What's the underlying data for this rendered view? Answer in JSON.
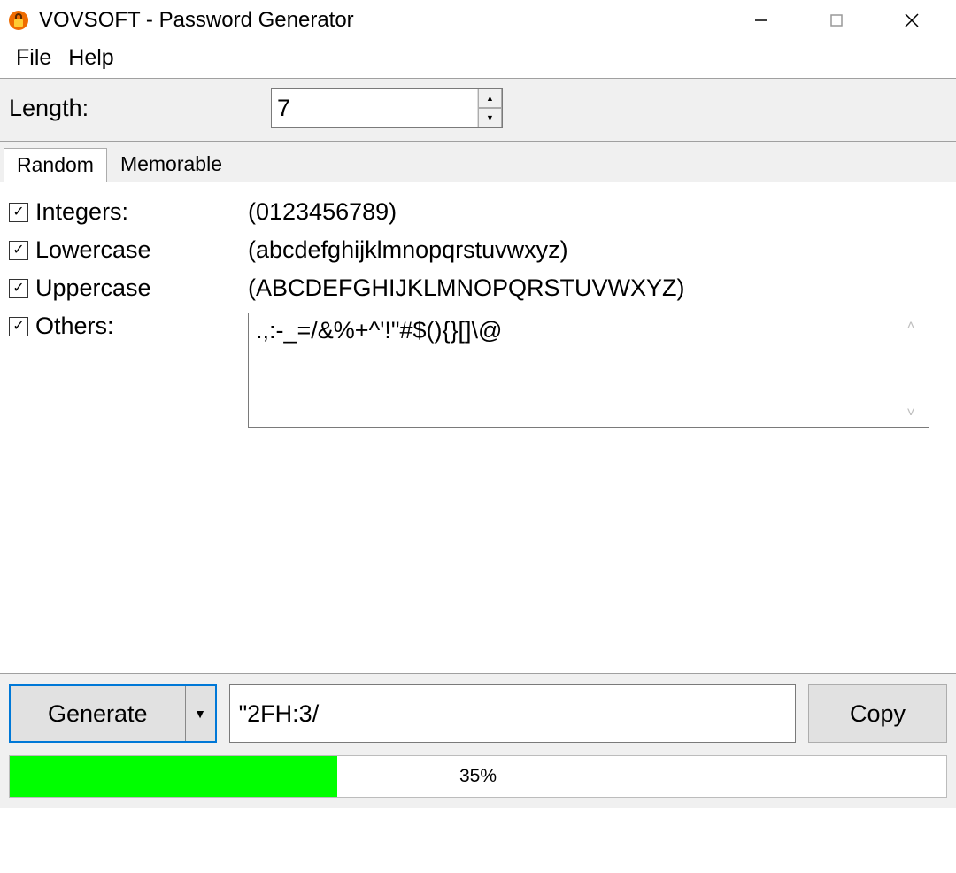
{
  "window": {
    "title": "VOVSOFT - Password Generator"
  },
  "menu": {
    "file": "File",
    "help": "Help"
  },
  "length": {
    "label": "Length:",
    "value": "7"
  },
  "tabs": {
    "random": "Random",
    "memorable": "Memorable",
    "active": "random"
  },
  "options": {
    "integers": {
      "label": "Integers:",
      "set": "(0123456789)",
      "checked": true
    },
    "lowercase": {
      "label": "Lowercase",
      "set": "(abcdefghijklmnopqrstuvwxyz)",
      "checked": true
    },
    "uppercase": {
      "label": "Uppercase",
      "set": "(ABCDEFGHIJKLMNOPQRSTUVWXYZ)",
      "checked": true
    },
    "others": {
      "label": "Others:",
      "set": ".,:-_=/&%+^'!\"#$(){}[]\\@",
      "checked": true
    }
  },
  "actions": {
    "generate": "Generate",
    "copy": "Copy"
  },
  "result": {
    "password": "\"2FH:3/"
  },
  "strength": {
    "percent": 35,
    "label": "35%",
    "color": "#00ff00"
  }
}
